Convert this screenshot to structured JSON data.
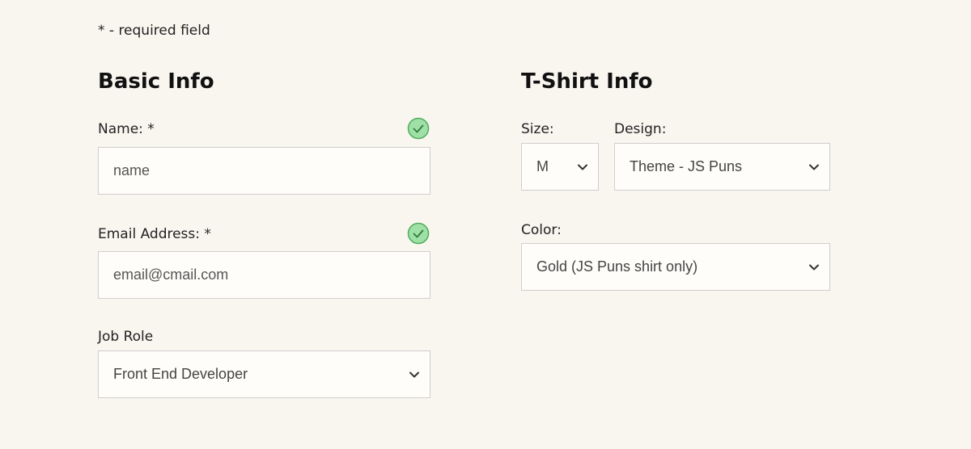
{
  "required_note": "* - required field",
  "basic_info": {
    "title": "Basic Info",
    "name": {
      "label": "Name: *",
      "value": "name"
    },
    "email": {
      "label": "Email Address: *",
      "value": "email@cmail.com"
    },
    "job_role": {
      "label": "Job Role",
      "selected": "Front End Developer"
    }
  },
  "tshirt_info": {
    "title": "T-Shirt Info",
    "size": {
      "label": "Size:",
      "selected": "M"
    },
    "design": {
      "label": "Design:",
      "selected": "Theme - JS Puns"
    },
    "color": {
      "label": "Color:",
      "selected": "Gold (JS Puns shirt only)"
    }
  },
  "colors": {
    "background": "#f9f5ef",
    "valid_icon_fill": "#9fe0a7",
    "valid_icon_stroke": "#4fae5c"
  },
  "icons": {
    "valid": "check-circle-icon",
    "dropdown": "chevron-down-icon"
  }
}
